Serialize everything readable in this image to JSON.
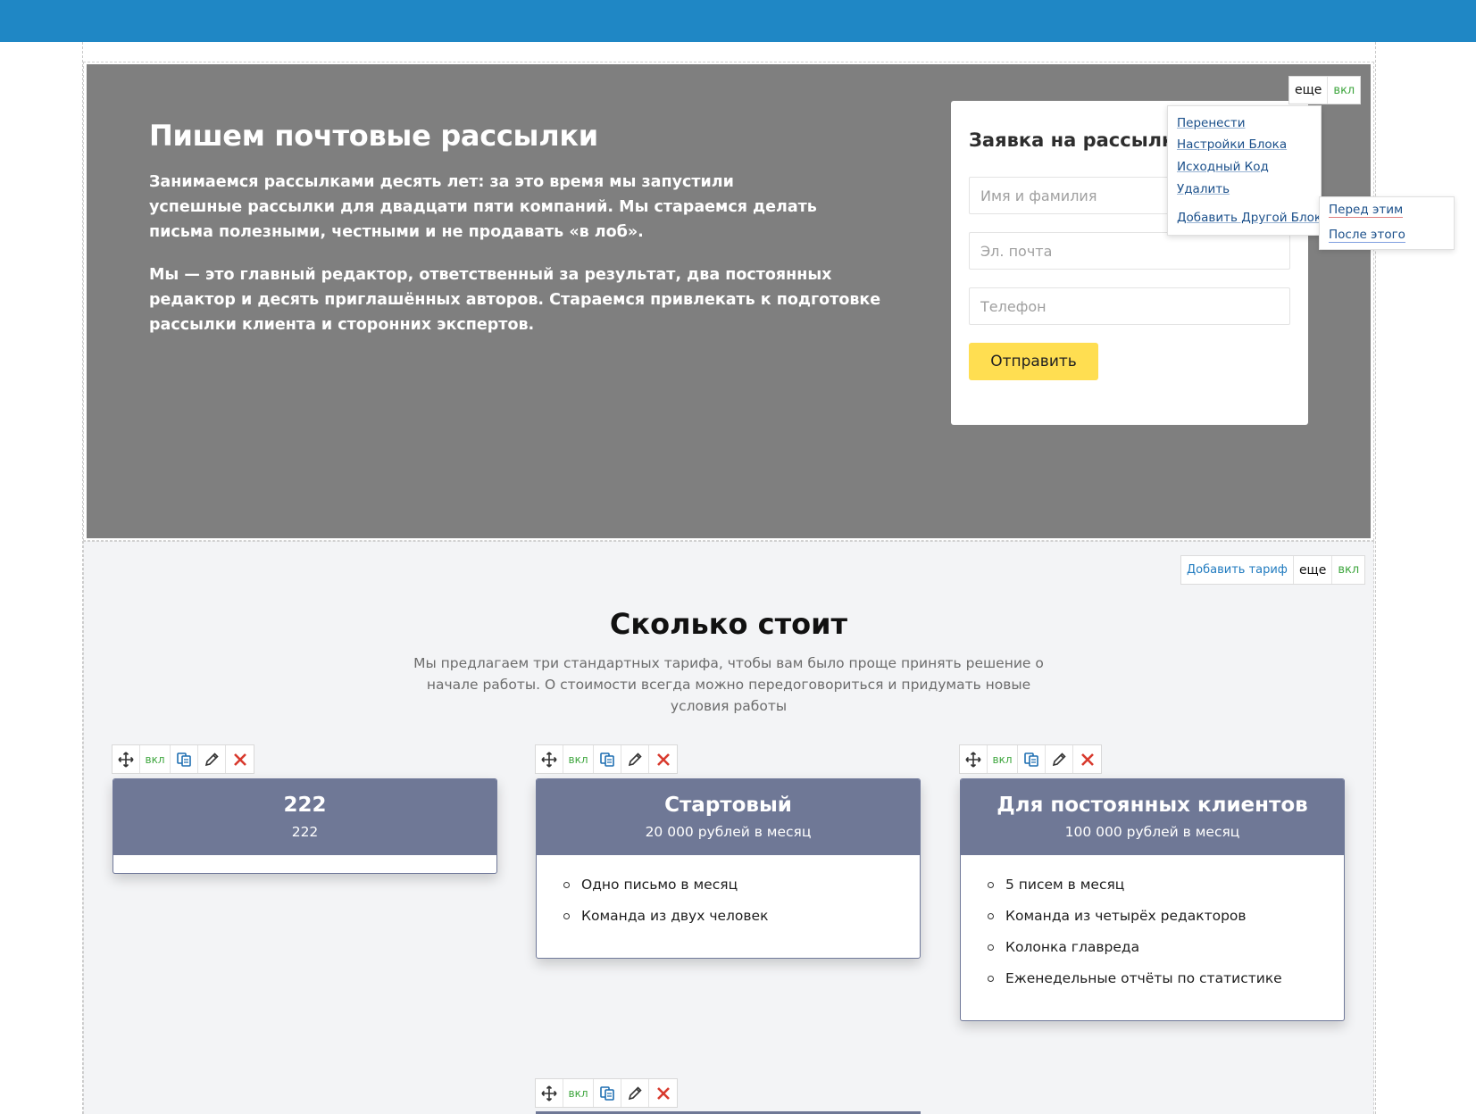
{
  "hero": {
    "title": "Пишем почтовые рассылки",
    "paragraph1": "Занимаемся рассылками десять лет: за это время мы запустили успешные рассылки для двадцати пяти компаний. Мы стараемся делать письма полезными, честными и не продавать «в лоб».",
    "paragraph2": "Мы — это главный редактор, ответственный за результат, два постоянных редактор и десять приглашённых авторов. Стараемся привлекать к подготовке рассылки клиента и сторонних экспертов."
  },
  "form": {
    "title": "Заявка на рассылку",
    "name_placeholder": "Имя и фамилия",
    "email_placeholder": "Эл. почта",
    "phone_placeholder": "Телефон",
    "submit_label": "Отправить"
  },
  "block_controls": {
    "more_label": "еще",
    "on_label": "вкл",
    "add_tariff_label": "Добавить тариф"
  },
  "menu": {
    "items": [
      "Перенести",
      "Настройки Блока",
      "Исходный Код",
      "Удалить",
      "Добавить Другой Блок"
    ],
    "submenu": [
      "Перед этим",
      "После этого"
    ]
  },
  "pricing": {
    "title": "Сколько стоит",
    "subtitle": "Мы предлагаем три стандартных тарифа, чтобы вам было проще принять решение о начале работы. О стоимости всегда можно передоговориться и придумать новые условия работы",
    "toolbar_on_label": "вкл",
    "cards": [
      {
        "name": "222",
        "price": "222",
        "features": []
      },
      {
        "name": "Стартовый",
        "price": "20 000 рублей в месяц",
        "features": [
          "Одно письмо в месяц",
          "Команда из двух человек"
        ]
      },
      {
        "name": "Для постоянных клиентов",
        "price": "100 000 рублей в месяц",
        "features": [
          "5 писем в месяц",
          "Команда из четырёх редакторов",
          "Колонка главреда",
          "Еженедельные отчёты по статистике"
        ]
      }
    ]
  },
  "colors": {
    "topbar": "#1f87c5",
    "hero_bg": "#7f7f7f",
    "submit_bg": "#ffde51",
    "card_header": "#6f7896",
    "on_green": "#3ea63e"
  },
  "icons": [
    "move-icon",
    "copy-icon",
    "pencil-icon",
    "delete-icon"
  ]
}
